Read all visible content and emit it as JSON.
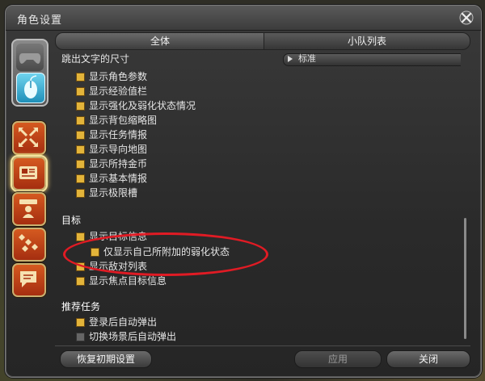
{
  "window": {
    "title": "角色设置"
  },
  "tabs": [
    {
      "label": "全体"
    },
    {
      "label": "小队列表"
    }
  ],
  "partial_section": {
    "label": "跳出文字的尺寸",
    "dropdown_value": "标准"
  },
  "options": [
    {
      "label": "显示角色参数",
      "checked": true
    },
    {
      "label": "显示经验值栏",
      "checked": true
    },
    {
      "label": "显示强化及弱化状态情况",
      "checked": true
    },
    {
      "label": "显示背包缩略图",
      "checked": true
    },
    {
      "label": "显示任务情报",
      "checked": true
    },
    {
      "label": "显示导向地图",
      "checked": true
    },
    {
      "label": "显示所持金币",
      "checked": true
    },
    {
      "label": "显示基本情报",
      "checked": true
    },
    {
      "label": "显示极限槽",
      "checked": true
    }
  ],
  "target_section": {
    "label": "目标",
    "items": [
      {
        "label": "显示目标信息",
        "checked": true
      },
      {
        "label": "仅显示自己所附加的弱化状态",
        "checked": true
      },
      {
        "label": "显示敌对列表",
        "checked": true
      },
      {
        "label": "显示焦点目标信息",
        "checked": true
      }
    ]
  },
  "duty_section": {
    "label": "推荐任务",
    "items": [
      {
        "label": "登录后自动弹出",
        "checked": true
      },
      {
        "label": "切换场景后自动弹出",
        "checked": false
      }
    ]
  },
  "buttons": {
    "reset": "恢复初期设置",
    "apply": "应用",
    "close": "关闭"
  },
  "colors": {
    "accent": "#e3b43a",
    "highlight": "#e01b24"
  }
}
